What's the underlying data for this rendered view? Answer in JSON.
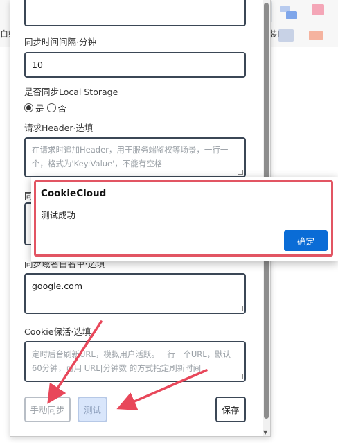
{
  "browser": {
    "read_aloud_icon": "read-aloud-icon",
    "favorites_icon": "star-icon",
    "collections_icon": "collections-icon",
    "extension_icon": "cookiecloud-icon",
    "extension_badge": "↑",
    "bookmark_left": "自媒",
    "bookmark_right": "装I"
  },
  "form": {
    "sync_interval": {
      "label": "同步时间间隔·分钟",
      "value": "10"
    },
    "local_storage": {
      "label": "是否同步Local Storage",
      "option_yes": "是",
      "option_no": "否",
      "selected": "是"
    },
    "header": {
      "label": "请求Header·选填",
      "placeholder": "在请求时追加Header，用于服务端鉴权等场景，一行一个，格式为'Key:Value'，不能有空格"
    },
    "hidden_label_fragment": "同",
    "domains": {
      "label": "同步域名白名单·选填",
      "value": "google.com"
    },
    "keepalive": {
      "label": "Cookie保活·选填",
      "placeholder": "定时后台刷新URL，模拟用户活跃。一行一个URL，默认60分钟，可用 URL|分钟数 的方式指定刷新时间"
    }
  },
  "buttons": {
    "manual_sync": "手动同步",
    "test": "测试",
    "save": "保存"
  },
  "dialog": {
    "title": "CookieCloud",
    "message": "测试成功",
    "ok": "确定"
  },
  "colors": {
    "highlight": "#e25563",
    "primary": "#0a6cd6",
    "arrow": "#e8475a"
  }
}
